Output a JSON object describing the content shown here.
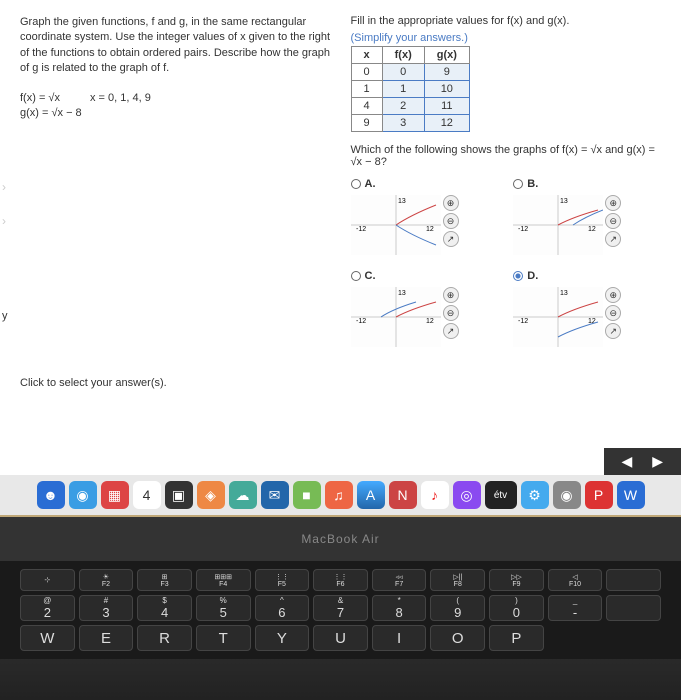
{
  "question": {
    "instructions": "Graph the given functions, f and g, in the same rectangular coordinate system. Use the integer values of x given to the right of the functions to obtain ordered pairs. Describe how the graph of g is related to the graph of f.",
    "f_def": "f(x) = √x",
    "g_def": "g(x) = √x − 8",
    "x_values": "x = 0, 1, 4, 9",
    "fill_prompt": "Fill in the appropriate values for f(x) and g(x).",
    "simplify_note": "(Simplify your answers.)",
    "graph_prompt": "Which of the following shows the graphs of f(x) = √x and g(x) = √x − 8?",
    "click_select": "Click to select your answer(s)."
  },
  "table": {
    "headers": [
      "x",
      "f(x)",
      "g(x)"
    ],
    "rows": [
      {
        "x": "0",
        "fx": "0",
        "gx": "9"
      },
      {
        "x": "1",
        "fx": "1",
        "gx": "10"
      },
      {
        "x": "4",
        "fx": "2",
        "gx": "11"
      },
      {
        "x": "9",
        "fx": "3",
        "gx": "12"
      }
    ]
  },
  "options": {
    "a": {
      "label": "A.",
      "selected": false
    },
    "b": {
      "label": "B.",
      "selected": false
    },
    "c": {
      "label": "C.",
      "selected": false
    },
    "d": {
      "label": "D.",
      "selected": true
    }
  },
  "graph_axis": {
    "min": "-12",
    "max": "12",
    "ytop": "13"
  },
  "laptop_name": "MacBook Air",
  "y_axis_label": "y",
  "dock": {
    "tv_label": "étv",
    "p_label": "P",
    "w_label": "W"
  },
  "fn_keys": [
    {
      "top": "⊹",
      "bottom": ""
    },
    {
      "top": "☀",
      "bottom": "F2"
    },
    {
      "top": "⊞",
      "bottom": "F3"
    },
    {
      "top": "⊞⊞⊞",
      "bottom": "F4"
    },
    {
      "top": "⋮⋮",
      "bottom": "F5"
    },
    {
      "top": "⋮⋮",
      "bottom": "F6"
    },
    {
      "top": "◃◃",
      "bottom": "F7"
    },
    {
      "top": "▷||",
      "bottom": "F8"
    },
    {
      "top": "▷▷",
      "bottom": "F9"
    },
    {
      "top": "◁",
      "bottom": "F10"
    }
  ],
  "num_row": [
    {
      "top": "@",
      "main": "2"
    },
    {
      "top": "#",
      "main": "3"
    },
    {
      "top": "$",
      "main": "4"
    },
    {
      "top": "%",
      "main": "5"
    },
    {
      "top": "^",
      "main": "6"
    },
    {
      "top": "&",
      "main": "7"
    },
    {
      "top": "*",
      "main": "8"
    },
    {
      "top": "(",
      "main": "9"
    },
    {
      "top": ")",
      "main": "0"
    },
    {
      "top": "_",
      "main": "-"
    }
  ],
  "letter_row": [
    "W",
    "E",
    "R",
    "T",
    "Y",
    "U",
    "I",
    "O",
    "P"
  ]
}
